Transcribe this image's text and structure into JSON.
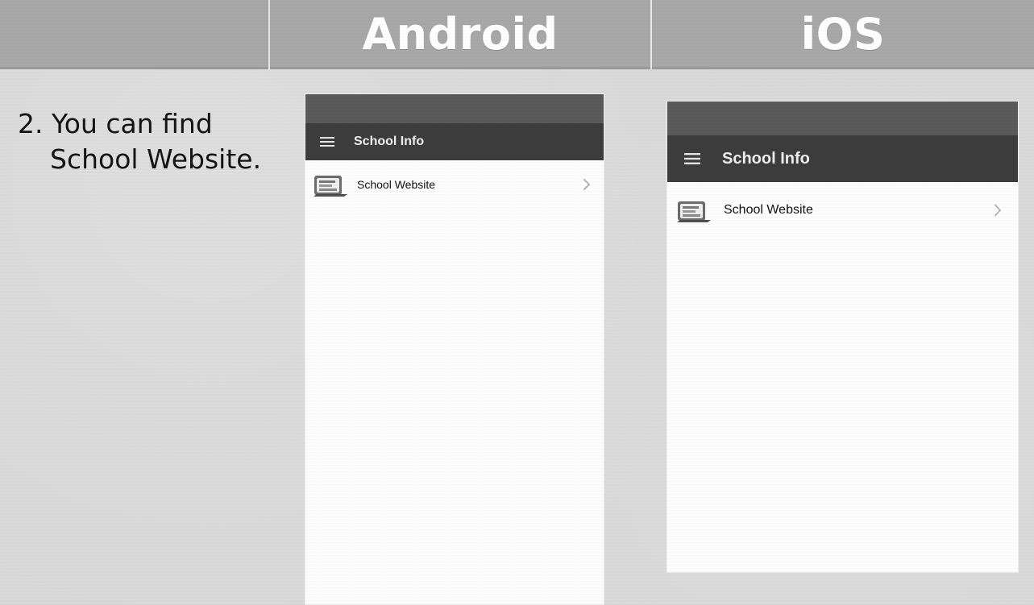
{
  "header": {
    "col_android_label": "Android",
    "col_ios_label": "iOS"
  },
  "step": {
    "line1": "2. You can find",
    "line2": "School Website."
  },
  "android": {
    "status_left": "",
    "status_right": "",
    "app_title": "School Info",
    "list": [
      {
        "label": "School Website"
      }
    ]
  },
  "ios": {
    "status_left": "",
    "status_right": "",
    "app_title": "School Info",
    "list": [
      {
        "label": "School Website"
      }
    ]
  },
  "icons": {
    "menu": "hamburger-menu-icon",
    "website": "website-icon",
    "chevron": "chevron-right-icon"
  },
  "colors": {
    "header_bg": "#a8a8a8",
    "appbar_bg": "#3d3d3d",
    "page_bg": "#d8d8d8",
    "screen_bg": "#ffffff"
  }
}
